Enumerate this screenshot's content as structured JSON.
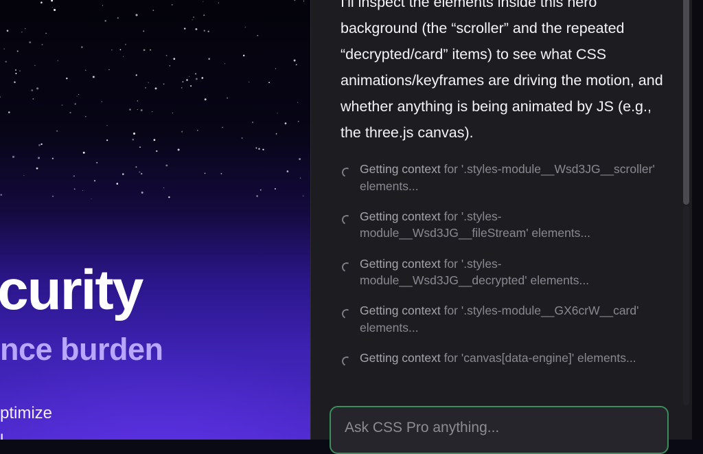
{
  "hero": {
    "headline": "curity",
    "subheadline": "nce burden",
    "bullet_1": "ptimize",
    "bullet_2": "l"
  },
  "assistant": {
    "message": "I'll inspect the elements inside this hero background (the “scroller” and the repeated “decrypted/card” items) to see what CSS animations/keyframes are driving the motion, and whether anything is being animated by JS (e.g., the three.js canvas).",
    "tool_calls": [
      {
        "lead": "Getting context",
        "text": " for '.styles-module__Wsd3JG__scroller' elements..."
      },
      {
        "lead": "Getting context",
        "text": " for '.styles-module__Wsd3JG__fileStream' elements..."
      },
      {
        "lead": "Getting context",
        "text": " for '.styles-module__Wsd3JG__decrypted' elements..."
      },
      {
        "lead": "Getting context",
        "text": " for '.styles-module__GX6crW__card' elements..."
      },
      {
        "lead": "Getting context",
        "text": " for 'canvas[data-engine]' elements..."
      }
    ]
  },
  "composer": {
    "placeholder": "Ask CSS Pro anything..."
  },
  "colors": {
    "accent_border": "#3c8f5c",
    "panel_bg": "#1d1c21",
    "hero_purple": "#4a29c8",
    "subhead_lavender": "#b9a6ff"
  }
}
